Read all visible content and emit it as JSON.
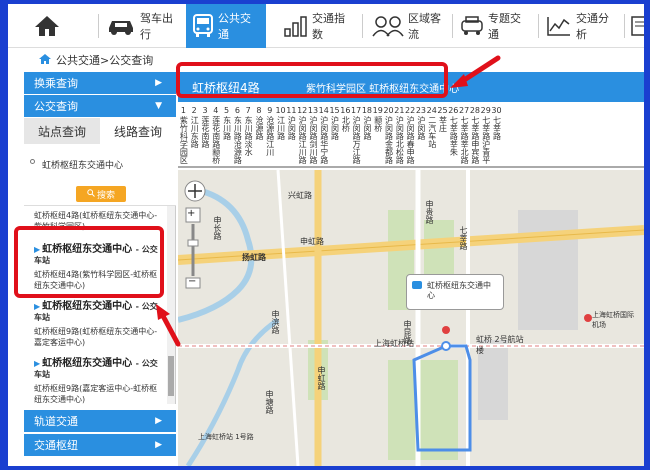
{
  "nav": {
    "items": [
      {
        "label": "",
        "icon": "home-icon"
      },
      {
        "label": "驾车出行",
        "icon": "car-icon"
      },
      {
        "label": "公共交通",
        "icon": "bus-icon",
        "active": true
      },
      {
        "label": "交通指数",
        "icon": "bar-chart-icon"
      },
      {
        "label": "区域客流",
        "icon": "people-icon"
      },
      {
        "label": "专题交通",
        "icon": "taxi-icon"
      },
      {
        "label": "交通分析",
        "icon": "line-chart-icon"
      },
      {
        "label": "",
        "icon": "document-icon"
      }
    ]
  },
  "breadcrumb": "公共交通>公交查询",
  "sidebar": {
    "transfer_label": "换乘查询",
    "bus_label": "公交查询",
    "tabs": [
      "站点查询",
      "线路查询"
    ],
    "search_value": "虹桥枢纽东交通中心",
    "search_button": "搜索",
    "results": [
      {
        "title": "",
        "type": "",
        "detail": "虹桥枢纽4路(虹桥枢纽东交通中心-紫竹科学园区)"
      },
      {
        "title": "虹桥枢纽东交通中心",
        "type": "- 公交车站",
        "detail": "虹桥枢纽4路(紫竹科学园区-虹桥枢纽东交通中心)"
      },
      {
        "title": "虹桥枢纽东交通中心",
        "type": "- 公交车站",
        "detail": "虹桥枢纽9路(虹桥枢纽东交通中心-嘉定客运中心)"
      },
      {
        "title": "虹桥枢纽东交通中心",
        "type": "- 公交车站",
        "detail": "虹桥枢纽9路(嘉定客运中心-虹桥枢纽东交通中心)"
      }
    ],
    "rail_label": "轨道交通",
    "hub_label": "交通枢纽"
  },
  "route": {
    "name": "虹桥枢纽4路",
    "direction": "紫竹科学园区 虹桥枢纽东交通中心"
  },
  "stops": [
    {
      "n": "1",
      "name": "紫竹科学园区"
    },
    {
      "n": "2",
      "name": "江川东路"
    },
    {
      "n": "3",
      "name": "莲花南路"
    },
    {
      "n": "4",
      "name": "莲花南路颛桥"
    },
    {
      "n": "5",
      "name": "东川路"
    },
    {
      "n": "6",
      "name": "东川路沧源路"
    },
    {
      "n": "7",
      "name": "东川路淡水"
    },
    {
      "n": "8",
      "name": "沧源路"
    },
    {
      "n": "9",
      "name": "沧源路江川"
    },
    {
      "n": "10",
      "name": "江川路"
    },
    {
      "n": "11",
      "name": "沪闵路"
    },
    {
      "n": "12",
      "name": "沪闵路江川路"
    },
    {
      "n": "13",
      "name": "沪闵路剑川路"
    },
    {
      "n": "14",
      "name": "沪闵路华宁路"
    },
    {
      "n": "15",
      "name": "沪闵路"
    },
    {
      "n": "16",
      "name": "北桥"
    },
    {
      "n": "17",
      "name": "沪闵路万江路"
    },
    {
      "n": "18",
      "name": "沪闵路"
    },
    {
      "n": "19",
      "name": "颛桥"
    },
    {
      "n": "20",
      "name": "沪闵路金都路"
    },
    {
      "n": "21",
      "name": "沪闵路北松路"
    },
    {
      "n": "22",
      "name": "沪闵路春申路"
    },
    {
      "n": "23",
      "name": "沪闵路"
    },
    {
      "n": "24",
      "name": "二汽车站"
    },
    {
      "n": "25",
      "name": "莘庄"
    },
    {
      "n": "26",
      "name": "七莘路莘朱"
    },
    {
      "n": "27",
      "name": "七莘路莘北路"
    },
    {
      "n": "28",
      "name": "七莘路申宾路"
    },
    {
      "n": "29",
      "name": "七莘路沪青平"
    },
    {
      "n": "30",
      "name": "七莘路"
    }
  ],
  "map": {
    "popup": "虹桥枢纽东交通中心",
    "labels": [
      "兴虹路",
      "申虹路",
      "申长路",
      "扬虹路",
      "申滨路",
      "申贵路",
      "申昆路",
      "七莘路",
      "虹桥 2号航站楼",
      "上海虹桥国际机场",
      "上海虹桥站",
      "上海虹桥站 1号路",
      "申虹路",
      "申塘路"
    ]
  },
  "colors": {
    "accent": "#2a8fe0",
    "callout": "#e0101a",
    "background": "#1a3fd0"
  }
}
